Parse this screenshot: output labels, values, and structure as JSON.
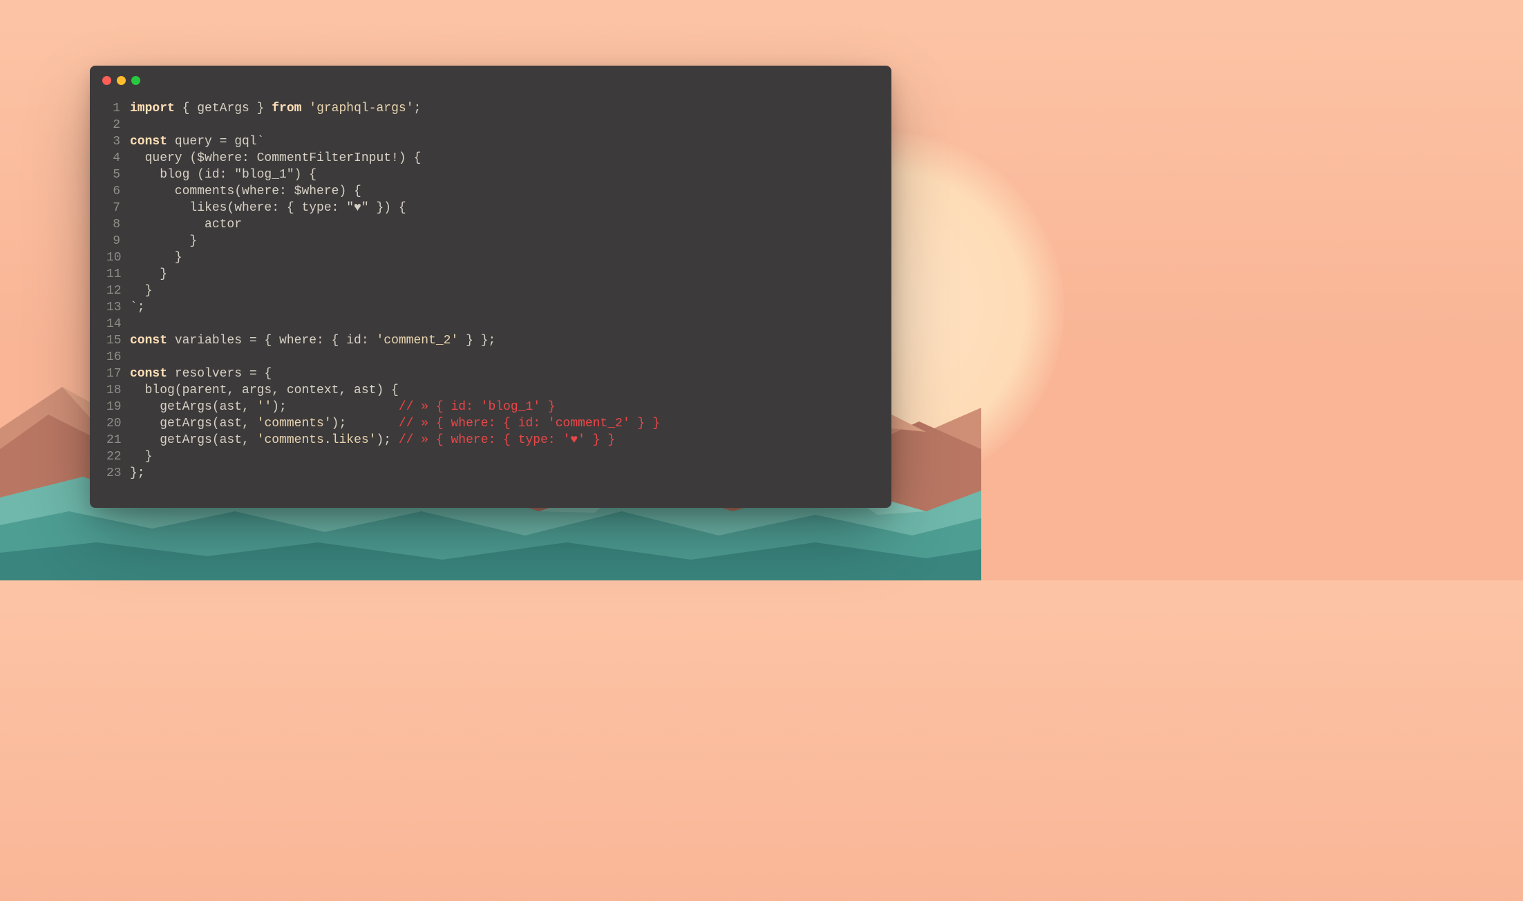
{
  "traffic_lights": {
    "close": "close-icon",
    "minimize": "minimize-icon",
    "zoom": "zoom-icon"
  },
  "code": {
    "lines": [
      {
        "n": "1",
        "tokens": [
          {
            "cls": "keyword",
            "t": "import"
          },
          {
            "cls": "default",
            "t": " { getArgs } "
          },
          {
            "cls": "keyword",
            "t": "from"
          },
          {
            "cls": "default",
            "t": " "
          },
          {
            "cls": "string",
            "t": "'graphql-args'"
          },
          {
            "cls": "default",
            "t": ";"
          }
        ]
      },
      {
        "n": "2",
        "tokens": [
          {
            "cls": "default",
            "t": ""
          }
        ]
      },
      {
        "n": "3",
        "tokens": [
          {
            "cls": "keyword",
            "t": "const"
          },
          {
            "cls": "default",
            "t": " query = gql`"
          }
        ]
      },
      {
        "n": "4",
        "tokens": [
          {
            "cls": "default",
            "t": "  query ($where: CommentFilterInput!) {"
          }
        ]
      },
      {
        "n": "5",
        "tokens": [
          {
            "cls": "default",
            "t": "    blog (id: \"blog_1\") {"
          }
        ]
      },
      {
        "n": "6",
        "tokens": [
          {
            "cls": "default",
            "t": "      comments(where: $where) {"
          }
        ]
      },
      {
        "n": "7",
        "tokens": [
          {
            "cls": "default",
            "t": "        likes(where: { type: \"♥\" }) {"
          }
        ]
      },
      {
        "n": "8",
        "tokens": [
          {
            "cls": "default",
            "t": "          actor"
          }
        ]
      },
      {
        "n": "9",
        "tokens": [
          {
            "cls": "default",
            "t": "        }"
          }
        ]
      },
      {
        "n": "10",
        "tokens": [
          {
            "cls": "default",
            "t": "      }"
          }
        ]
      },
      {
        "n": "11",
        "tokens": [
          {
            "cls": "default",
            "t": "    }"
          }
        ]
      },
      {
        "n": "12",
        "tokens": [
          {
            "cls": "default",
            "t": "  }"
          }
        ]
      },
      {
        "n": "13",
        "tokens": [
          {
            "cls": "default",
            "t": "`;"
          }
        ]
      },
      {
        "n": "14",
        "tokens": [
          {
            "cls": "default",
            "t": ""
          }
        ]
      },
      {
        "n": "15",
        "tokens": [
          {
            "cls": "keyword",
            "t": "const"
          },
          {
            "cls": "default",
            "t": " variables = { where: { id: "
          },
          {
            "cls": "string",
            "t": "'comment_2'"
          },
          {
            "cls": "default",
            "t": " } };"
          }
        ]
      },
      {
        "n": "16",
        "tokens": [
          {
            "cls": "default",
            "t": ""
          }
        ]
      },
      {
        "n": "17",
        "tokens": [
          {
            "cls": "keyword",
            "t": "const"
          },
          {
            "cls": "default",
            "t": " resolvers = {"
          }
        ]
      },
      {
        "n": "18",
        "tokens": [
          {
            "cls": "default",
            "t": "  blog(parent, args, context, ast) {"
          }
        ]
      },
      {
        "n": "19",
        "tokens": [
          {
            "cls": "default",
            "t": "    getArgs(ast, "
          },
          {
            "cls": "string",
            "t": "''"
          },
          {
            "cls": "default",
            "t": ");               "
          },
          {
            "cls": "comment",
            "t": "// » { id: 'blog_1' }"
          }
        ]
      },
      {
        "n": "20",
        "tokens": [
          {
            "cls": "default",
            "t": "    getArgs(ast, "
          },
          {
            "cls": "string",
            "t": "'comments'"
          },
          {
            "cls": "default",
            "t": ");       "
          },
          {
            "cls": "comment",
            "t": "// » { where: { id: 'comment_2' } }"
          }
        ]
      },
      {
        "n": "21",
        "tokens": [
          {
            "cls": "default",
            "t": "    getArgs(ast, "
          },
          {
            "cls": "string",
            "t": "'comments.likes'"
          },
          {
            "cls": "default",
            "t": "); "
          },
          {
            "cls": "comment",
            "t": "// » { where: { type: '♥' } }"
          }
        ]
      },
      {
        "n": "22",
        "tokens": [
          {
            "cls": "default",
            "t": "  }"
          }
        ]
      },
      {
        "n": "23",
        "tokens": [
          {
            "cls": "default",
            "t": "};"
          }
        ]
      }
    ]
  }
}
